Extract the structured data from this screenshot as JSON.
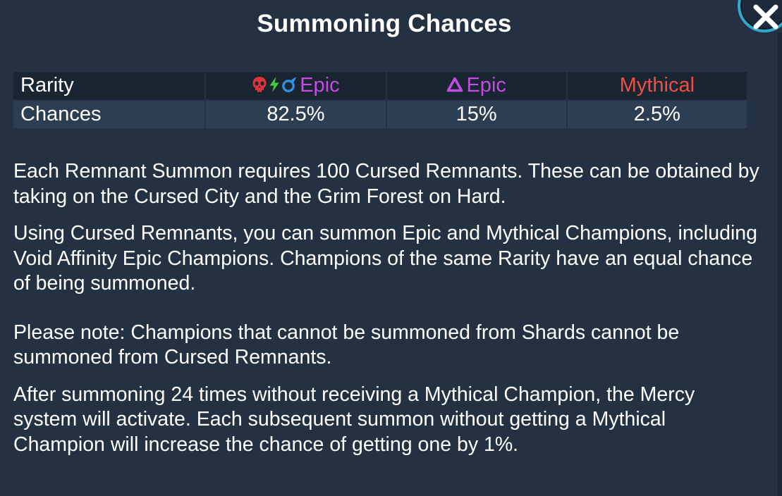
{
  "dialog": {
    "title": "Summoning Chances"
  },
  "table": {
    "header": {
      "label": "Rarity",
      "col1": "Epic",
      "col2": "Epic",
      "col3": "Mythical"
    },
    "row": {
      "label": "Chances",
      "col1": "82.5%",
      "col2": "15%",
      "col3": "2.5%"
    }
  },
  "paragraphs": [
    "Each Remnant Summon requires 100 Cursed Remnants. These can be obtained by taking on the Cursed City and the Grim Forest on Hard.",
    "Using Cursed Remnants, you can summon Epic and Mythical Champions, including Void Affinity Epic Champions. Champions of the same Rarity have an equal chance of being summoned.",
    "Please note: Champions that cannot be summoned from Shards cannot be summoned from Cursed Remnants.",
    "After summoning 24 times without receiving a Mythical Champion, the Mercy system will activate. Each subsequent summon without getting a Mythical Champion will increase the chance of getting one by 1%."
  ],
  "icons": {
    "col1": [
      "force-affinity-icon",
      "magic-affinity-icon",
      "spirit-affinity-icon"
    ],
    "col2": "void-affinity-icon",
    "close": "close-icon"
  },
  "colors": {
    "background": "#233142",
    "header_row": "#1a2532",
    "data_row": "#2c3e51",
    "epic": "#c24de5",
    "mythical": "#ef4e45",
    "force": "#e0343d",
    "magic": "#3fd03a",
    "spirit": "#2f8fe0",
    "close_ring": "#2fa9c8"
  }
}
